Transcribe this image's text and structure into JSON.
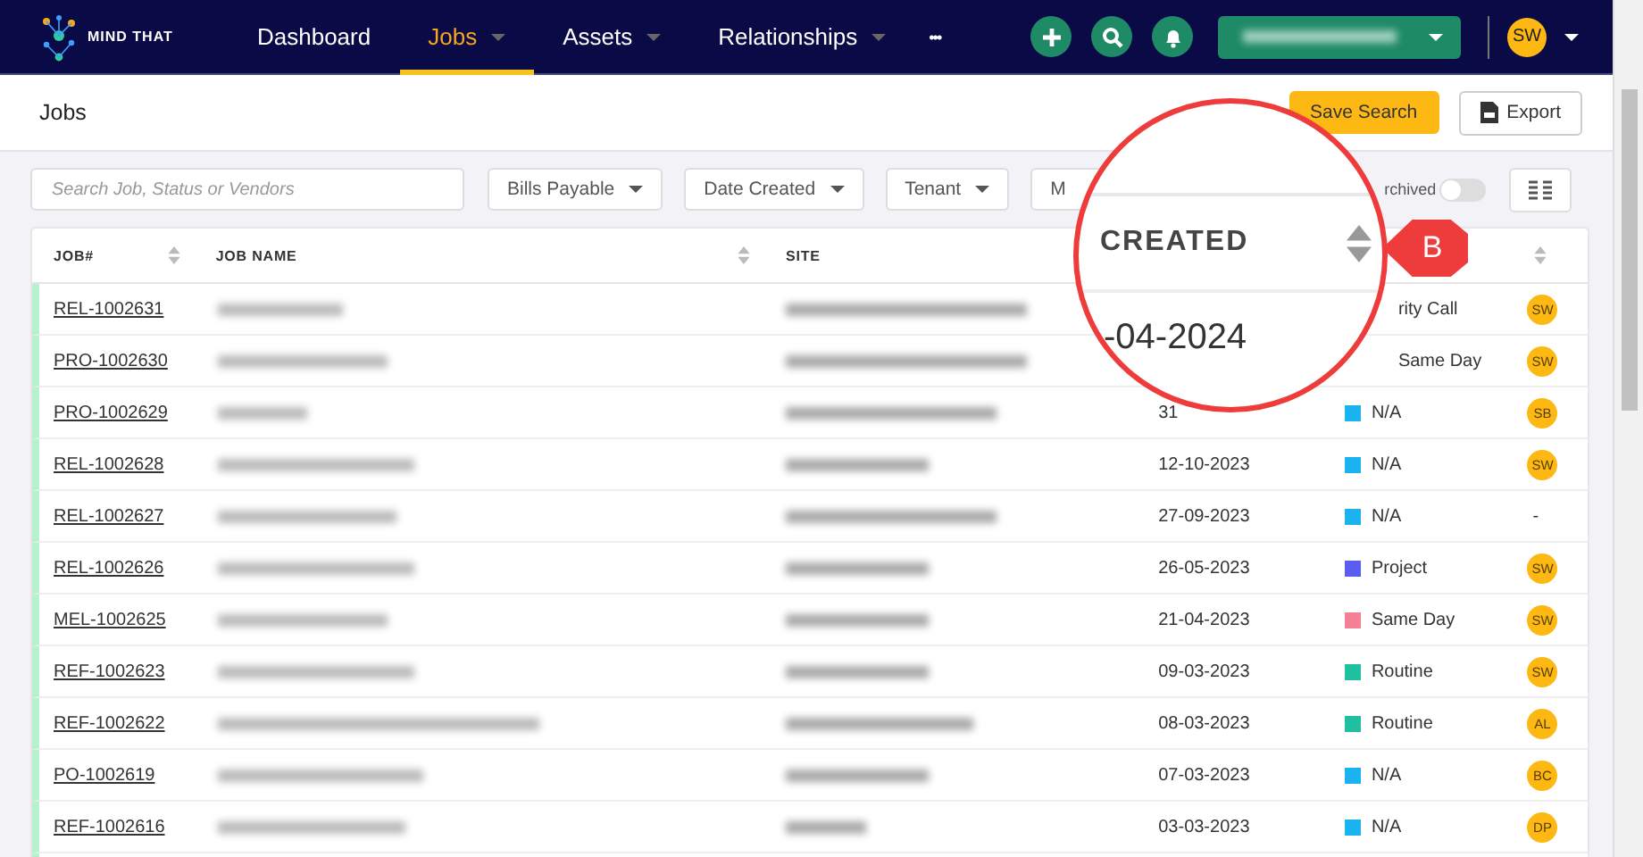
{
  "nav": {
    "logo": "MIND THAT",
    "items": [
      {
        "label": "Dashboard",
        "selected": false,
        "dropdown": false
      },
      {
        "label": "Jobs",
        "selected": true,
        "dropdown": true
      },
      {
        "label": "Assets",
        "selected": false,
        "dropdown": true
      },
      {
        "label": "Relationships",
        "selected": false,
        "dropdown": true
      }
    ],
    "more": "•••",
    "user": "SW"
  },
  "page": {
    "title": "Jobs",
    "buttons": [
      {
        "label": "Save Search",
        "kind": "primary"
      },
      {
        "label": "Export",
        "kind": "export"
      }
    ]
  },
  "filters": {
    "search_placeholder": "Search Job, Status or Vendors",
    "dropdowns": [
      "Bills Payable",
      "Date Created",
      "Tenant"
    ],
    "partial_field": "M",
    "archived_label": "rchived",
    "archived_on": false
  },
  "table": {
    "columns": [
      {
        "label": "JOB#",
        "sortable": true
      },
      {
        "label": "JOB NAME",
        "sortable": true
      },
      {
        "label": "SITE",
        "sortable": false
      }
    ],
    "rows": [
      {
        "job": "REL-1002631",
        "status": "rity Call",
        "assignee": "SW"
      },
      {
        "job": "PRO-1002630",
        "status": "Same Day",
        "assignee": "SW"
      },
      {
        "job": "PRO-1002629",
        "created": "31",
        "status": "N/A",
        "color": "#1ab3f0",
        "assignee": "SB"
      },
      {
        "job": "REL-1002628",
        "created": "12-10-2023",
        "status": "N/A",
        "color": "#1ab3f0",
        "assignee": "SW"
      },
      {
        "job": "REL-1002627",
        "created": "27-09-2023",
        "status": "N/A",
        "color": "#1ab3f0",
        "assignee": "-"
      },
      {
        "job": "REL-1002626",
        "created": "26-05-2023",
        "status": "Project",
        "color": "#5b5cf0",
        "assignee": "SW"
      },
      {
        "job": "MEL-1002625",
        "created": "21-04-2023",
        "status": "Same Day",
        "color": "#f57f95",
        "assignee": "SW"
      },
      {
        "job": "REF-1002623",
        "created": "09-03-2023",
        "status": "Routine",
        "color": "#1fc0a0",
        "assignee": "SW"
      },
      {
        "job": "REF-1002622",
        "created": "08-03-2023",
        "status": "Routine",
        "color": "#1fc0a0",
        "assignee": "AL"
      },
      {
        "job": "PO-1002619",
        "created": "07-03-2023",
        "status": "N/A",
        "color": "#1ab3f0",
        "assignee": "BC"
      },
      {
        "job": "REF-1002616",
        "created": "03-03-2023",
        "status": "N/A",
        "color": "#1ab3f0",
        "assignee": "DP"
      }
    ]
  },
  "magnifier": {
    "header": "CREATED",
    "value": "-04-2024",
    "badge": "B"
  }
}
